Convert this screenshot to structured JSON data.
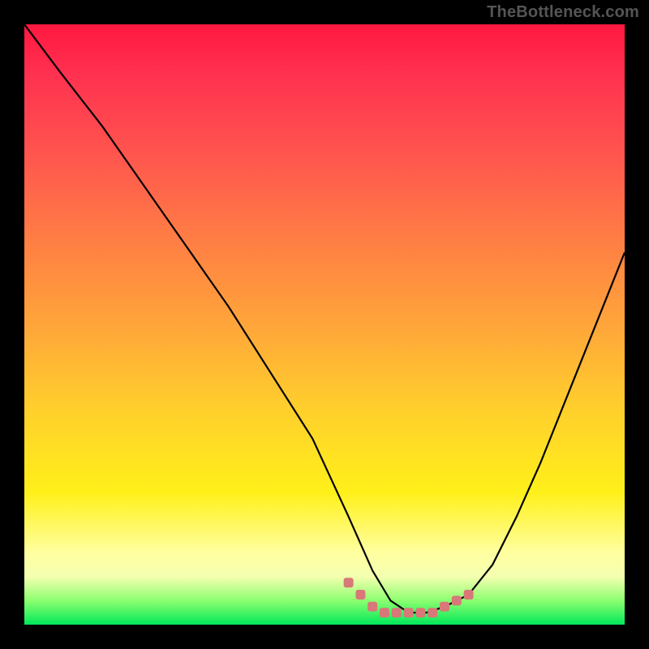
{
  "watermark": "TheBottleneck.com",
  "colors": {
    "page_bg": "#000000",
    "curve_stroke": "#000000",
    "marker_fill": "#d87878",
    "marker_stroke": "#b84040"
  },
  "chart_data": {
    "type": "line",
    "title": "",
    "xlabel": "",
    "ylabel": "",
    "xlim": [
      0,
      100
    ],
    "ylim": [
      0,
      100
    ],
    "series": [
      {
        "name": "bottleneck-curve",
        "x": [
          0,
          6,
          13,
          20,
          27,
          34,
          41,
          48,
          54,
          58,
          61,
          64,
          67,
          70,
          74,
          78,
          82,
          86,
          90,
          94,
          98,
          100
        ],
        "values": [
          100,
          92,
          83,
          73,
          63,
          53,
          42,
          31,
          18,
          9,
          4,
          2,
          2,
          3,
          5,
          10,
          18,
          27,
          37,
          47,
          57,
          62
        ]
      }
    ],
    "markers": {
      "name": "highlighted-range",
      "x": [
        54,
        56,
        58,
        60,
        62,
        64,
        66,
        68,
        70,
        72,
        74
      ],
      "values": [
        7,
        5,
        3,
        2,
        2,
        2,
        2,
        2,
        3,
        4,
        5
      ]
    }
  }
}
